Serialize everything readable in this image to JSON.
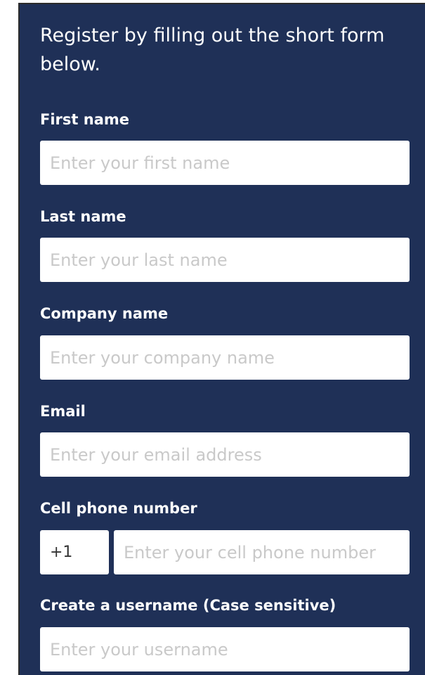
{
  "intro_text": "Register by filling out the short form below.",
  "fields": {
    "first_name": {
      "label": "First name",
      "placeholder": "Enter your first name",
      "value": ""
    },
    "last_name": {
      "label": "Last name",
      "placeholder": "Enter your last name",
      "value": ""
    },
    "company_name": {
      "label": "Company name",
      "placeholder": "Enter your company name",
      "value": ""
    },
    "email": {
      "label": "Email",
      "placeholder": "Enter your email address",
      "value": ""
    },
    "cell_phone": {
      "label": "Cell phone number",
      "country_code": "+1",
      "placeholder": "Enter your cell phone number",
      "value": ""
    },
    "username": {
      "label": "Create a username (Case sensitive)",
      "placeholder": "Enter your username",
      "value": ""
    }
  },
  "colors": {
    "panel_background": "#1f3057",
    "label_text": "#ffffff",
    "input_background": "#ffffff",
    "placeholder_text": "#c9c9c9"
  }
}
